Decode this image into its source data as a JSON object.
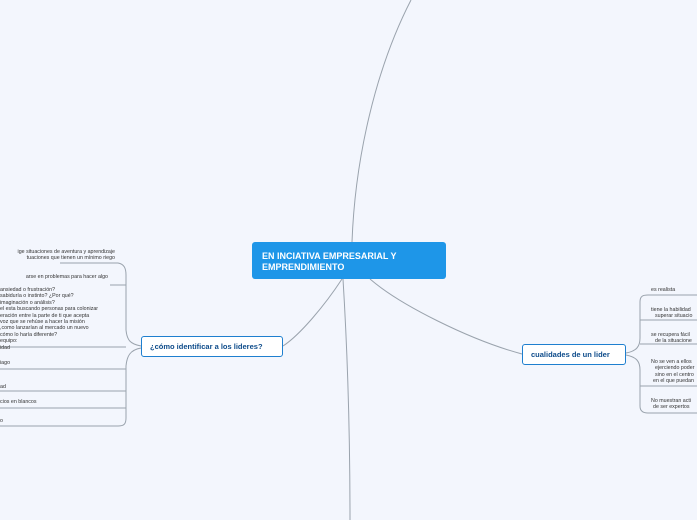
{
  "central": {
    "line1": "EN INCIATIVA EMPRESARIAL Y",
    "line2": "EMPRENDIMIENTO"
  },
  "left_topic": {
    "label": "¿cómo identificar a los lideres?",
    "items": [
      {
        "lines": [
          "ige situaciones de aventura y aprendizaje",
          "tuaciones que tienen un mínimo riego"
        ]
      },
      {
        "lines": [
          "arse en problemas para hacer algo"
        ]
      },
      {
        "lines": [
          "ansiedad o frustración?",
          "sabiduría o instinto? ¿Por qué?",
          "imaginación o análisis?",
          "el esta buscando personas para colonizar",
          "eración entre la parte de ti que acepta",
          "voz que se rehúse a hacer la misión",
          ",como lanzarían al mercado un nuevo",
          "cómo lo haría diferente?",
          "equipo:",
          "idad"
        ]
      },
      {
        "lines": [
          "iago"
        ]
      },
      {
        "lines": [
          "ad"
        ]
      },
      {
        "lines": [
          "cios en blancos"
        ]
      },
      {
        "lines": [
          "o"
        ]
      }
    ]
  },
  "right_topic": {
    "label": "cualidades de un lider",
    "items": [
      {
        "lines": [
          "es realista"
        ]
      },
      {
        "lines": [
          "tiene la habilidad",
          "superar situacio"
        ]
      },
      {
        "lines": [
          "se recupera fácil",
          "de la situacione"
        ]
      },
      {
        "lines": [
          "No se ven a ellos",
          "ejerciendo poder",
          "sino en el centro",
          "en el que puedan"
        ]
      },
      {
        "lines": [
          "No muestran acti",
          "de ser expertos"
        ]
      }
    ]
  },
  "colors": {
    "background": "#f3f6fd",
    "central_fill": "#1e96e8",
    "topic_border": "#1e7fcf",
    "topic_text": "#0d4b8a",
    "connector": "#9aa3ad"
  }
}
